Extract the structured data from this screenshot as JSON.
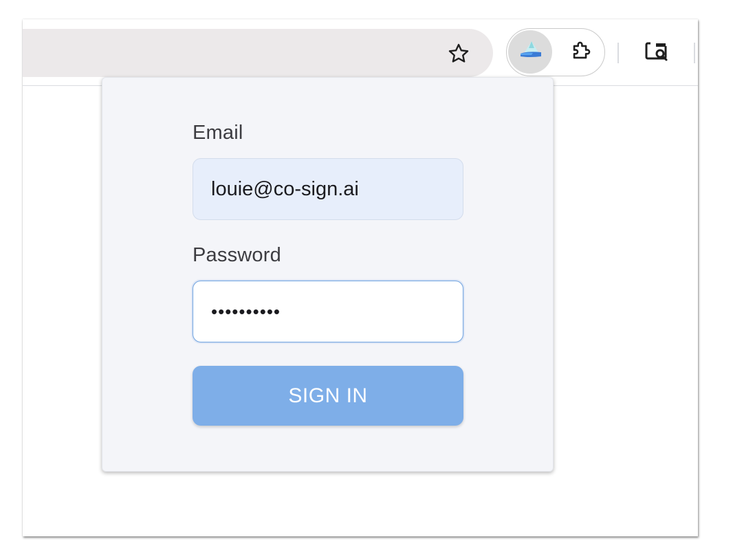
{
  "toolbar": {
    "icons": {
      "bookmark": "star-outline-icon",
      "active_extension": "co-sign-extension-icon",
      "extensions": "puzzle-piece-icon",
      "lens": "google-lens-icon"
    }
  },
  "login": {
    "email_label": "Email",
    "email_value": "louie@co-sign.ai",
    "password_label": "Password",
    "password_value": "••••••••••",
    "sign_in_label": "SIGN IN"
  },
  "colors": {
    "popup_bg": "#f4f5f9",
    "email_bg": "#e7eefb",
    "password_border": "#6fa3e0",
    "button_bg": "#7eaee8",
    "omnibox_bg": "#ece9ea"
  }
}
